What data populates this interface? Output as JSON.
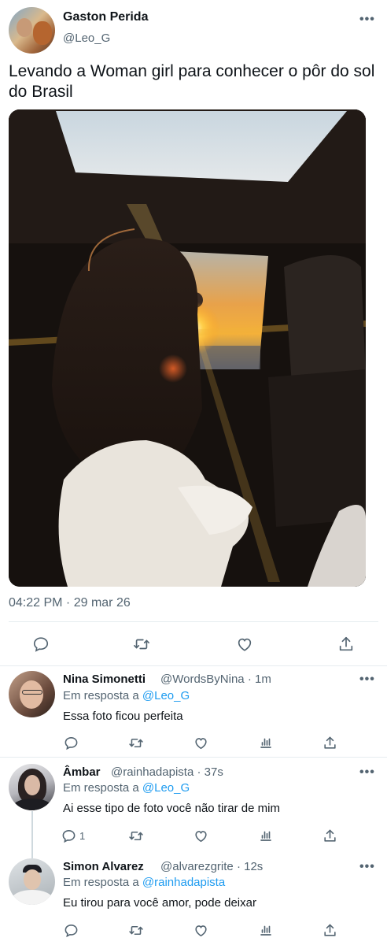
{
  "main_tweet": {
    "author_name": "Gaston Perida",
    "author_handle": "@Leo_G",
    "text": "Levando a Woman girl para conhecer o pôr do sol do Brasil",
    "timestamp": "04:22 PM · 29 mar 26",
    "more_label": "•••",
    "actions": [
      "reply-icon",
      "retweet-icon",
      "like-icon",
      "share-icon"
    ]
  },
  "replies": [
    {
      "name": "Nina Simonetti",
      "handle": "@WordsByNina",
      "time": "· 1m",
      "in_reply_prefix": "Em resposta a ",
      "in_reply_to": "@Leo_G",
      "text": "Essa foto ficou perfeita",
      "reply_count": ""
    },
    {
      "name": "Âmbar",
      "handle": "@rainhadapista",
      "time": "· 37s",
      "in_reply_prefix": "Em resposta a ",
      "in_reply_to": "@Leo_G",
      "text": "Ai esse tipo de foto você não tirar de mim",
      "reply_count": "1"
    },
    {
      "name": "Simon Alvarez",
      "handle": "@alvarezgrite",
      "time": "· 12s",
      "in_reply_prefix": "Em resposta a ",
      "in_reply_to": "@rainhadapista",
      "text": "Eu tirou para você amor, pode deixar",
      "reply_count": ""
    }
  ],
  "reply_more_label": "•••",
  "colors": {
    "link": "#1d9bf0",
    "secondary": "#536471",
    "text": "#0f1419",
    "divider": "#e6ecf0"
  }
}
